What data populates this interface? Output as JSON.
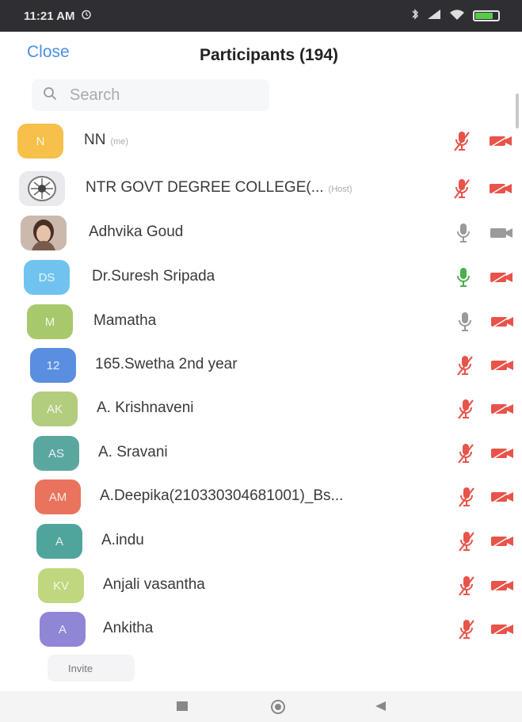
{
  "status_bar": {
    "time": "11:21 AM"
  },
  "header": {
    "close_label": "Close",
    "title": "Participants (194)"
  },
  "search": {
    "placeholder": "Search"
  },
  "participants": [
    {
      "initials": "N",
      "name": "NN",
      "tag": "(me)",
      "avatar_color": "#f6c04a",
      "mic": "muted",
      "video": "off"
    },
    {
      "initials": "",
      "name": "NTR GOVT DEGREE COLLEGE(...",
      "tag": "(Host)",
      "avatar_color": "#e9e9ee",
      "avatar_photo": "logo",
      "mic": "muted",
      "video": "off"
    },
    {
      "initials": "",
      "name": "Adhvika Goud",
      "tag": "",
      "avatar_color": "#d9cfc8",
      "avatar_photo": "person",
      "mic": "unmuted",
      "video": "on"
    },
    {
      "initials": "DS",
      "name": "Dr.Suresh Sripada",
      "tag": "",
      "avatar_color": "#6fc3ee",
      "mic": "speaking",
      "video": "off"
    },
    {
      "initials": "M",
      "name": "Mamatha",
      "tag": "",
      "avatar_color": "#a8c96b",
      "mic": "unmuted",
      "video": "off"
    },
    {
      "initials": "12",
      "name": "165.Swetha 2nd year",
      "tag": "",
      "avatar_color": "#5a8fe0",
      "mic": "muted",
      "video": "off"
    },
    {
      "initials": "AK",
      "name": "A. Krishnaveni",
      "tag": "",
      "avatar_color": "#b2cd7e",
      "mic": "muted",
      "video": "off"
    },
    {
      "initials": "AS",
      "name": "A. Sravani",
      "tag": "",
      "avatar_color": "#5aa7a0",
      "mic": "muted",
      "video": "off"
    },
    {
      "initials": "AM",
      "name": "A.Deepika(210330304681001)_Bs...",
      "tag": "",
      "avatar_color": "#e9735c",
      "mic": "muted",
      "video": "off"
    },
    {
      "initials": "A",
      "name": "A.indu",
      "tag": "",
      "avatar_color": "#4fa59c",
      "mic": "muted",
      "video": "off"
    },
    {
      "initials": "KV",
      "name": "Anjali vasantha",
      "tag": "",
      "avatar_color": "#bfd77e",
      "mic": "muted",
      "video": "off"
    },
    {
      "initials": "A",
      "name": "Ankitha",
      "tag": "",
      "avatar_color": "#8f86d6",
      "mic": "muted",
      "video": "off"
    }
  ],
  "footer": {
    "invite_label": "Invite"
  },
  "colors": {
    "accent": "#4a8fe0",
    "muted_red": "#e8534a",
    "speaking_green": "#4cae4c",
    "neutral_gray": "#9a9a9a"
  },
  "icons": {
    "status": [
      "alarm-icon",
      "bluetooth-icon",
      "signal-icon",
      "wifi-icon",
      "battery-icon"
    ],
    "nav": [
      "recents-icon",
      "home-icon",
      "back-icon"
    ]
  }
}
